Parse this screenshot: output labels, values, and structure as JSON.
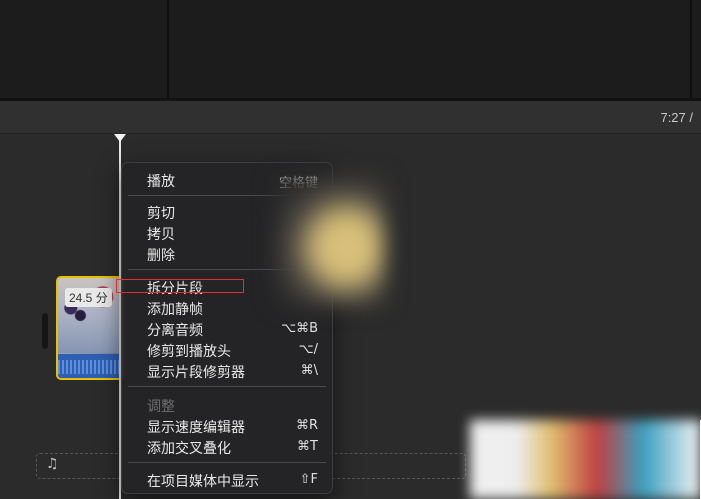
{
  "timeline": {
    "timecode": "7:27 /"
  },
  "clip": {
    "duration": "24.5 分"
  },
  "music_track": {
    "icon": "music-note-icon",
    "glyph": "♫"
  },
  "context_menu": {
    "items": [
      {
        "label": "播放",
        "shortcut": "空格键"
      },
      {
        "label": "剪切",
        "shortcut": ""
      },
      {
        "label": "拷贝",
        "shortcut": ""
      },
      {
        "label": "删除",
        "shortcut": ""
      },
      {
        "label": "拆分片段",
        "shortcut": ""
      },
      {
        "label": "添加静帧",
        "shortcut": ""
      },
      {
        "label": "分离音频",
        "shortcut": "⌥⌘B"
      },
      {
        "label": "修剪到播放头",
        "shortcut": "⌥/"
      },
      {
        "label": "显示片段修剪器",
        "shortcut": "⌘\\"
      },
      {
        "label": "调整",
        "shortcut": ""
      },
      {
        "label": "显示速度编辑器",
        "shortcut": "⌘R"
      },
      {
        "label": "添加交叉叠化",
        "shortcut": "⌘T"
      },
      {
        "label": "在项目媒体中显示",
        "shortcut": "⇧F"
      }
    ]
  },
  "colors": {
    "clip_border": "#e6c200",
    "highlight": "#e03030"
  }
}
